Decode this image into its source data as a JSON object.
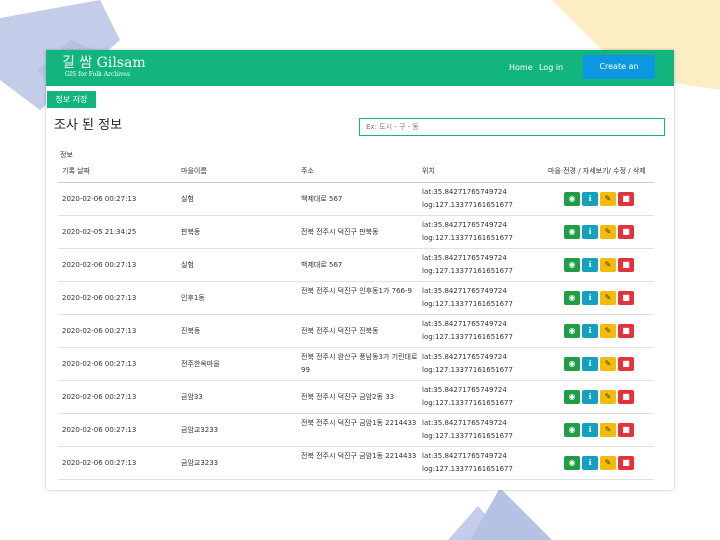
{
  "navbar": {
    "brand_title": "길 쌈 Gilsam",
    "brand_subtitle": "GIS for Folk Archives",
    "home_label": "Home",
    "login_label": "Log in",
    "create_account_label": "Create an account"
  },
  "toolbar": {
    "save_label": "정보 저장"
  },
  "page": {
    "title": "조사 된 정보",
    "search_placeholder": "Ex: 도시 - 구 - 동",
    "section_label": "정보"
  },
  "table": {
    "headers": [
      "기록 날짜",
      "마을이름",
      "주소",
      "위치",
      "마을 전경 / 자세보기/ 수정 / 삭제"
    ],
    "rows": [
      {
        "date": "2020-02-06 00:27:13",
        "name": "실험",
        "address": "백제대로 567",
        "lat": "lat:35.84271765749724",
        "log": "log:127.13377161651677"
      },
      {
        "date": "2020-02-05 21:34:25",
        "name": "판북동",
        "address": "전북 전주시 덕진구 판북동",
        "lat": "lat:35.84271765749724",
        "log": "log:127.13377161651677"
      },
      {
        "date": "2020-02-06 00:27:13",
        "name": "실험",
        "address": "백제대로 567",
        "lat": "lat:35.84271765749724",
        "log": "log:127.13377161651677"
      },
      {
        "date": "2020-02-06 00:27:13",
        "name": "인후1동",
        "address": "전북 전주시 덕진구 인후동1가 766-9",
        "lat": "lat:35.84271765749724",
        "log": "log:127.13377161651677"
      },
      {
        "date": "2020-02-06 00:27:13",
        "name": "진북동",
        "address": "전북 전주시 덕진구 진북동",
        "lat": "lat:35.84271765749724",
        "log": "log:127.13377161651677"
      },
      {
        "date": "2020-02-06 00:27:13",
        "name": "전주한옥마을",
        "address": "전북 전주시 완산구 풍남동3가 기린대로 99",
        "lat": "lat:35.84271765749724",
        "log": "log:127.13377161651677"
      },
      {
        "date": "2020-02-06 00:27:13",
        "name": "금암33",
        "address": "전북 전주시 덕진구 금암2동 33",
        "lat": "lat:35.84271765749724",
        "log": "log:127.13377161651677"
      },
      {
        "date": "2020-02-06 00:27:13",
        "name": "금암교3233",
        "address": "전북 전주시 덕진구 금암1동 2214433",
        "lat": "lat:35.84271765749724",
        "log": "log:127.13377161651677"
      },
      {
        "date": "2020-02-06 00:27:13",
        "name": "금암교3233",
        "address": "전북 전주시 덕진구 금암1동 2214433",
        "lat": "lat:35.84271765749724",
        "log": "log:127.13377161651677"
      }
    ],
    "action_icons": [
      "eye-icon",
      "info-icon",
      "edit-icon",
      "trash-icon"
    ]
  },
  "colors": {
    "brand_green": "#12b57e",
    "cta_blue": "#0d97e2",
    "view_green": "#1f9e45",
    "info_teal": "#14a0be",
    "edit_yellow": "#f2bc09",
    "delete_red": "#e3323a"
  }
}
